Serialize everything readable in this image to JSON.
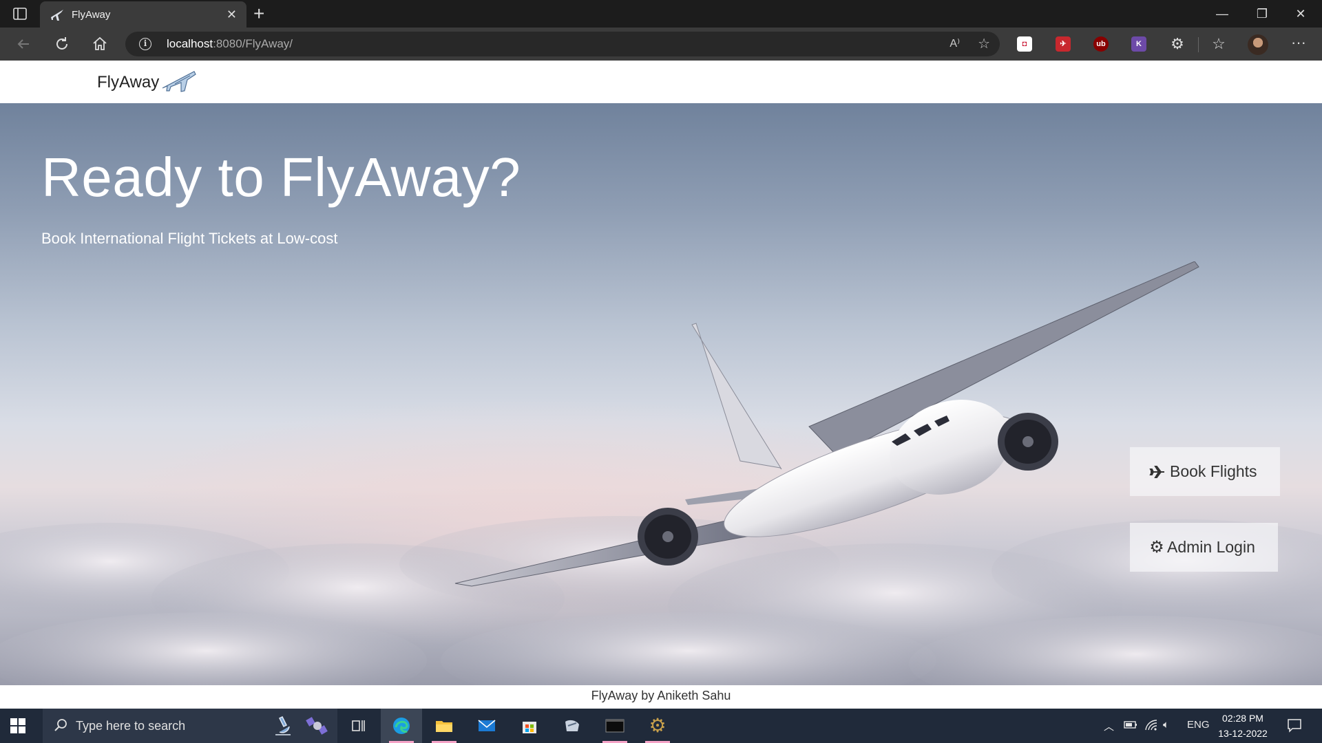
{
  "browser": {
    "tab_title": "FlyAway",
    "url_host": "localhost",
    "url_rest": ":8080/FlyAway/",
    "read_aloud": "A⁾"
  },
  "nav": {
    "brand": "FlyAway"
  },
  "hero": {
    "headline": "Ready to FlyAway?",
    "subline": "Book International Flight Tickets at Low-cost",
    "book_button": "Book Flights",
    "admin_button": "Admin Login"
  },
  "footer": {
    "text": "FlyAway by Aniketh Sahu"
  },
  "taskbar": {
    "search_placeholder": "Type here to search",
    "lang": "ENG",
    "time": "02:28 PM",
    "date": "13-12-2022"
  },
  "colors": {
    "hero_text": "#ffffff",
    "taskbar_bg": "#202a3a",
    "edge_underline": "#f5a3c7"
  },
  "icons": [
    "tab-actions-icon",
    "plane-favicon",
    "close-icon",
    "new-tab-icon",
    "back-icon",
    "refresh-icon",
    "home-icon",
    "info-icon",
    "read-aloud-icon",
    "add-favorite-icon",
    "extensions-icon",
    "favorites-icon",
    "more-icon",
    "windows-start-icon",
    "search-icon",
    "task-view-icon",
    "edge-icon",
    "file-explorer-icon",
    "mail-icon",
    "store-icon",
    "gear-icon",
    "plane-icon"
  ]
}
